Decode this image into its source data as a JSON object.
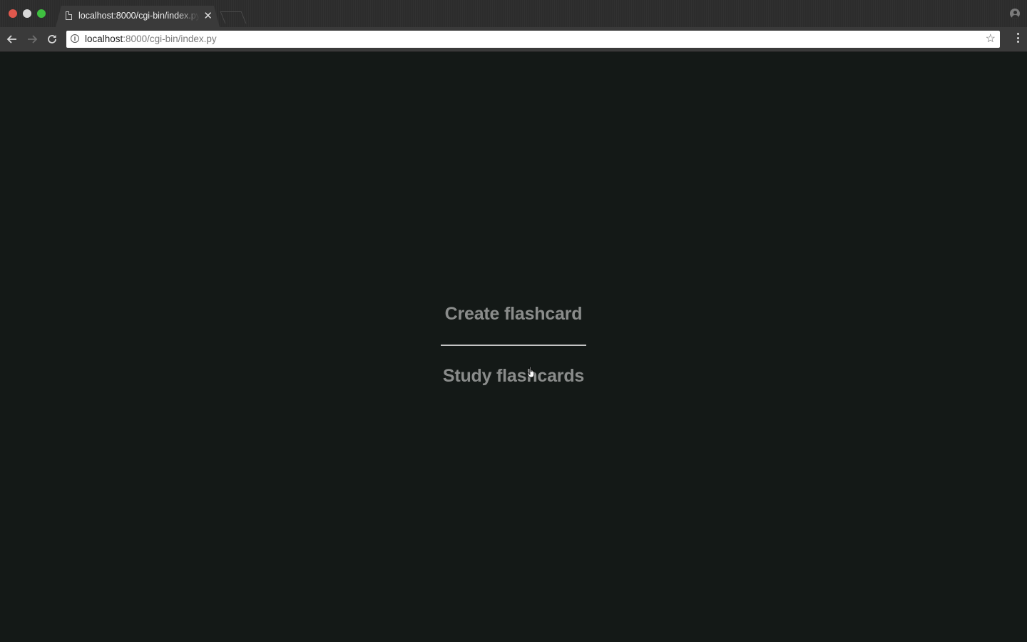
{
  "browser": {
    "tab": {
      "title": "localhost:8000/cgi-bin/index.py",
      "close_glyph": "✕",
      "icon": "document-icon"
    },
    "nav": {
      "back_glyph": "🡐",
      "forward_glyph": "🡒",
      "reload_glyph": "↻"
    },
    "address_bar": {
      "host": "localhost",
      "rest": ":8000/cgi-bin/index.py",
      "info_glyph": "i",
      "bookmark_glyph": "☆"
    }
  },
  "page": {
    "background": "#141917",
    "text_color": "#8a8c8b",
    "menu": {
      "create_label": "Create flashcard",
      "study_label": "Study flashcards"
    }
  }
}
